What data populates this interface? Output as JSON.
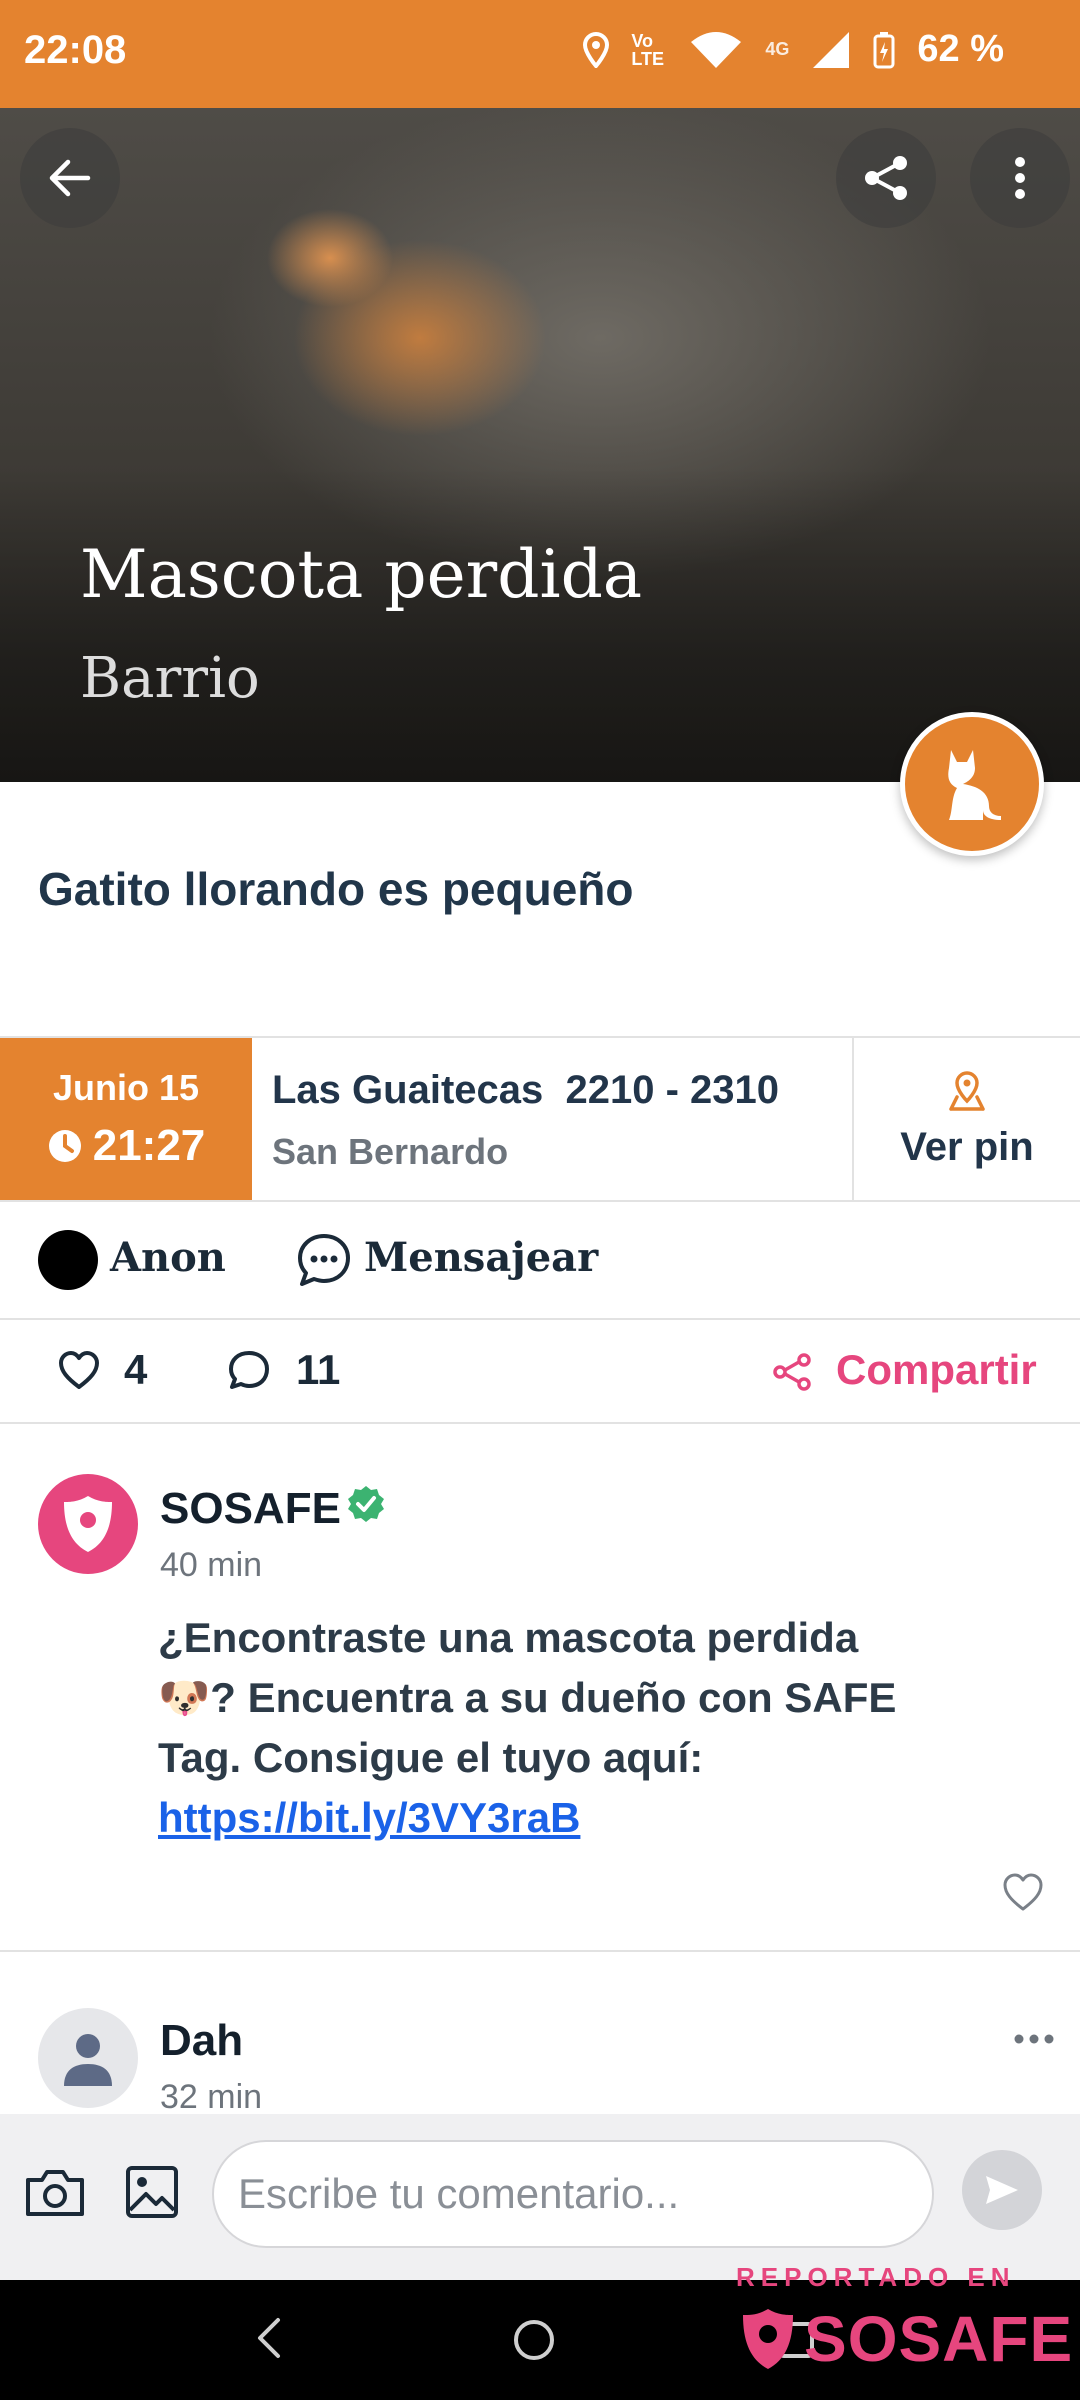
{
  "status_bar": {
    "time": "22:08",
    "network_label": "Vo LTE",
    "data_label": "4G",
    "battery": "62 %"
  },
  "hero": {
    "title": "Mascota perdida",
    "subtitle": "Barrio",
    "category_icon": "cat-icon"
  },
  "post": {
    "description": "Gatito llorando es pequeño",
    "date": "Junio 15",
    "time": "21:27",
    "address": "Las Guaitecas  2210 - 2310",
    "city": "San Bernardo",
    "pin_label": "Ver pin"
  },
  "user": {
    "name": "Anon",
    "message_label": "Mensajear"
  },
  "stats": {
    "likes": "4",
    "comments": "11",
    "share_label": "Compartir"
  },
  "comments": [
    {
      "author": "SOSAFE",
      "verified": true,
      "time": "40 min",
      "text_part1": "¿Encontraste una mascota perdida 🐶? Encuentra a su dueño con SAFE Tag. Consigue el tuyo aquí: ",
      "link": "https://bit.ly/3VY3raB"
    },
    {
      "author": "Dah",
      "time": "32 min"
    }
  ],
  "composer": {
    "placeholder": "Escribe tu comentario..."
  },
  "watermark": {
    "top_text": "REPORTADO EN",
    "brand": "SOSAFE"
  },
  "colors": {
    "brand_orange": "#e4832f",
    "brand_pink": "#e6467e",
    "link_blue": "#1a62e8",
    "verified_green": "#3cb371"
  }
}
